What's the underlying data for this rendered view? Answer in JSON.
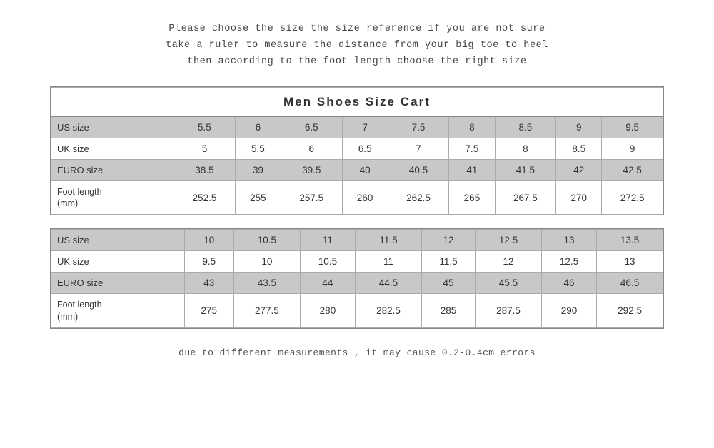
{
  "intro": {
    "line1": "Please choose the size the size reference if you are not sure",
    "line2": "take a ruler to measure the distance from your big toe to heel",
    "line3": "then  according  to  the foot length  choose  the right size"
  },
  "table1": {
    "title": "Men   Shoes   Size   Cart",
    "rows": [
      {
        "label": "US size",
        "shaded": true,
        "values": [
          "5.5",
          "6",
          "6.5",
          "7",
          "7.5",
          "8",
          "8.5",
          "9",
          "9.5"
        ]
      },
      {
        "label": "UK size",
        "shaded": false,
        "values": [
          "5",
          "5.5",
          "6",
          "6.5",
          "7",
          "7.5",
          "8",
          "8.5",
          "9"
        ]
      },
      {
        "label": "EURO size",
        "shaded": true,
        "values": [
          "38.5",
          "39",
          "39.5",
          "40",
          "40.5",
          "41",
          "41.5",
          "42",
          "42.5"
        ]
      },
      {
        "label": "Foot length\n(mm)",
        "shaded": false,
        "values": [
          "252.5",
          "255",
          "257.5",
          "260",
          "262.5",
          "265",
          "267.5",
          "270",
          "272.5"
        ]
      }
    ]
  },
  "table2": {
    "rows": [
      {
        "label": "US size",
        "shaded": true,
        "values": [
          "10",
          "10.5",
          "11",
          "11.5",
          "12",
          "12.5",
          "13",
          "13.5"
        ]
      },
      {
        "label": "UK size",
        "shaded": false,
        "values": [
          "9.5",
          "10",
          "10.5",
          "11",
          "11.5",
          "12",
          "12.5",
          "13"
        ]
      },
      {
        "label": "EURO size",
        "shaded": true,
        "values": [
          "43",
          "43.5",
          "44",
          "44.5",
          "45",
          "45.5",
          "46",
          "46.5"
        ]
      },
      {
        "label": "Foot length\n(mm)",
        "shaded": false,
        "values": [
          "275",
          "277.5",
          "280",
          "282.5",
          "285",
          "287.5",
          "290",
          "292.5"
        ]
      }
    ]
  },
  "footer": "due to different measurements , it may cause 0.2-0.4cm errors"
}
